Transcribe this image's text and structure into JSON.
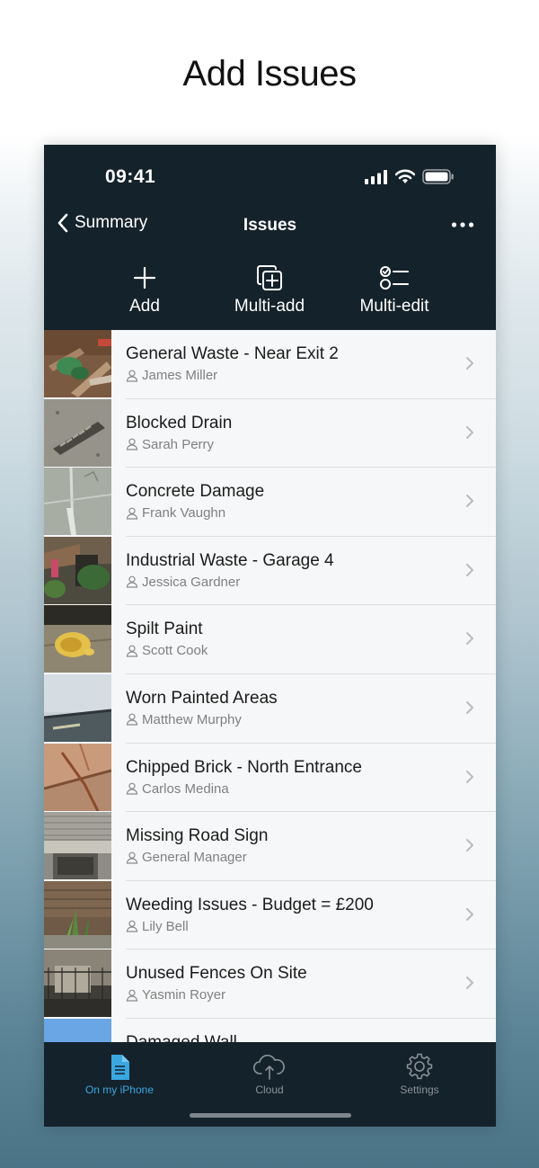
{
  "headline": "Add Issues",
  "status": {
    "time": "09:41"
  },
  "nav": {
    "back_label": "Summary",
    "title": "Issues"
  },
  "actions": [
    {
      "label": "Add",
      "icon": "plus-icon"
    },
    {
      "label": "Multi-add",
      "icon": "multi-add-icon"
    },
    {
      "label": "Multi-edit",
      "icon": "multi-edit-icon"
    }
  ],
  "issues": [
    {
      "title": "General Waste - Near Exit 2",
      "person": "James Miller"
    },
    {
      "title": "Blocked Drain",
      "person": "Sarah Perry"
    },
    {
      "title": "Concrete Damage",
      "person": "Frank Vaughn"
    },
    {
      "title": "Industrial Waste - Garage 4",
      "person": "Jessica Gardner"
    },
    {
      "title": "Spilt Paint",
      "person": "Scott Cook"
    },
    {
      "title": "Worn Painted Areas",
      "person": "Matthew Murphy"
    },
    {
      "title": "Chipped Brick - North Entrance",
      "person": "Carlos Medina"
    },
    {
      "title": "Missing Road Sign",
      "person": "General Manager"
    },
    {
      "title": "Weeding Issues - Budget = £200",
      "person": "Lily Bell"
    },
    {
      "title": "Unused Fences On Site",
      "person": "Yasmin Royer"
    },
    {
      "title": "Damaged Wall",
      "person": ""
    }
  ],
  "tabs": [
    {
      "label": "On my iPhone",
      "icon": "document-icon",
      "active": true
    },
    {
      "label": "Cloud",
      "icon": "cloud-icon",
      "active": false
    },
    {
      "label": "Settings",
      "icon": "gear-icon",
      "active": false
    }
  ],
  "colors": {
    "bar": "#14222b",
    "accent": "#3aa7e0",
    "list_bg": "#f6f7f8"
  }
}
